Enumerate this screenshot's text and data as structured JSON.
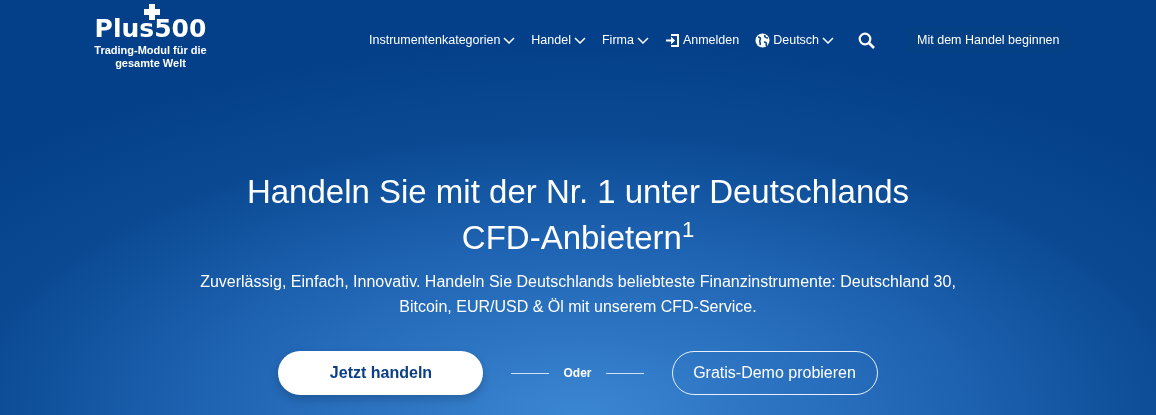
{
  "logo": {
    "text": "Plus500",
    "tagline": "Trading-Modul für die gesamte Welt"
  },
  "nav": [
    {
      "kind": "dropdown",
      "label": "Instrumentenkategorien"
    },
    {
      "kind": "dropdown",
      "label": "Handel"
    },
    {
      "kind": "dropdown",
      "label": "Firma"
    },
    {
      "kind": "login",
      "label": "Anmelden"
    },
    {
      "kind": "language",
      "label": "Deutsch"
    },
    {
      "kind": "search"
    },
    {
      "kind": "cta",
      "label": "Mit dem Handel beginnen"
    }
  ],
  "hero": {
    "headline": "Handeln Sie mit der Nr. 1 unter Deutschlands CFD-Anbietern$^{1}$",
    "subtitle": "Zuverlässig, Einfach, Innovativ. Handeln Sie Deutschlands beliebteste Finanzinstrumente: Deutschland 30, Bitcoin, EUR/USD & Öl mit unserem CFD-Service.",
    "primary_button": "Jetzt handeln",
    "separator": "Oder",
    "secondary_button": "Gratis-Demo probieren"
  }
}
